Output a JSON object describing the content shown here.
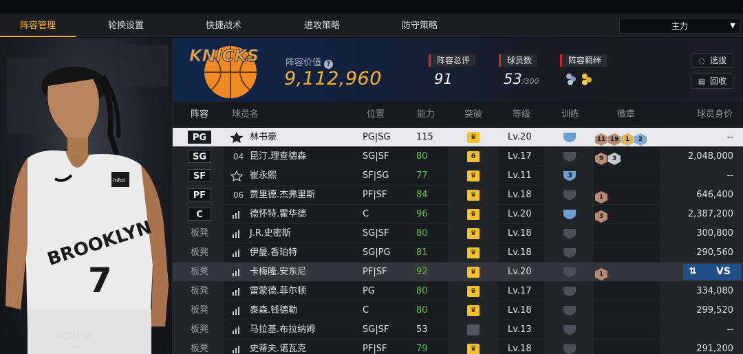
{
  "tabs": [
    "阵容管理",
    "轮换设置",
    "快捷战术",
    "进攻策略",
    "防守策略"
  ],
  "lineup_select": "主力",
  "player_panel": {
    "value_label": "时刻价值",
    "value": "--",
    "jersey_team": "BROOKLYN",
    "jersey_number": "7",
    "jersey_sponsor": "infor"
  },
  "summary": {
    "team_logo_text": "KNICKS",
    "team_value_label": "阵容价值",
    "team_value": "9,112,960",
    "rating_label": "阵容总评",
    "rating": "91",
    "players_label": "球员数",
    "players": "53",
    "players_max": "/300",
    "chemistry_label": "阵容羁绊",
    "buttons": {
      "select": "选拔",
      "recycle": "回收"
    }
  },
  "columns": [
    "阵容",
    "球员名",
    "位置",
    "能力",
    "突破",
    "等级",
    "训练",
    "徽章",
    "球员身价"
  ],
  "rows": [
    {
      "slot": "PG",
      "num": "",
      "name": "林书豪",
      "pos": "PG|SG",
      "ovr": "115",
      "green": false,
      "level": "Lv.20",
      "train": "",
      "badges": [
        [
          "11",
          "bronze"
        ],
        [
          "19",
          "bronze"
        ],
        [
          "1",
          "gold"
        ],
        [
          "2",
          "blue"
        ]
      ],
      "value": "--",
      "crown": "♛"
    },
    {
      "slot": "SG",
      "num": "04",
      "name": "昆汀.理查德森",
      "pos": "SG|SF",
      "ovr": "80",
      "green": true,
      "level": "Lv.17",
      "train": "",
      "badges": [
        [
          "9",
          "bronze"
        ],
        [
          "3",
          "silver"
        ]
      ],
      "value": "2,048,000",
      "crown": "6"
    },
    {
      "slot": "SF",
      "num": "",
      "name": "崔永熙",
      "pos": "SF|SG",
      "ovr": "77",
      "green": true,
      "level": "Lv.11",
      "train": "3",
      "badges": [],
      "value": "--",
      "crown": "♛"
    },
    {
      "slot": "PF",
      "num": "06",
      "name": "贾里德.杰弗里斯",
      "pos": "PF|SF",
      "ovr": "84",
      "green": true,
      "level": "Lv.18",
      "train": "",
      "badges": [
        [
          "1",
          "bronze"
        ]
      ],
      "value": "646,400",
      "crown": "♛"
    },
    {
      "slot": "C",
      "num": "",
      "name": "德怀特.霍华德",
      "pos": "C",
      "ovr": "96",
      "green": true,
      "level": "Lv.20",
      "train": "",
      "badges": [
        [
          "3",
          "bronze"
        ]
      ],
      "value": "2,387,200",
      "crown": "♛"
    },
    {
      "slot": "板凳",
      "num": "",
      "name": "J.R.史密斯",
      "pos": "SG|SF",
      "ovr": "80",
      "green": true,
      "level": "Lv.18",
      "train": "",
      "badges": [],
      "value": "300,800",
      "crown": "♛"
    },
    {
      "slot": "板凳",
      "num": "",
      "name": "伊曼.香珀特",
      "pos": "SG|PG",
      "ovr": "81",
      "green": true,
      "level": "Lv.18",
      "train": "",
      "badges": [],
      "value": "290,560",
      "crown": "♛"
    },
    {
      "slot": "板凳",
      "num": "",
      "name": "卡梅隆.安东尼",
      "pos": "PF|SF",
      "ovr": "92",
      "green": true,
      "level": "Lv.20",
      "train": "",
      "badges": [
        [
          "1",
          "bronze"
        ]
      ],
      "value": "VS",
      "crown": "♛"
    },
    {
      "slot": "板凳",
      "num": "",
      "name": "雷蒙德.菲尔顿",
      "pos": "PG",
      "ovr": "80",
      "green": true,
      "level": "Lv.17",
      "train": "",
      "badges": [],
      "value": "334,080",
      "crown": "♛"
    },
    {
      "slot": "板凳",
      "num": "",
      "name": "泰森.钱德勒",
      "pos": "C",
      "ovr": "80",
      "green": true,
      "level": "Lv.18",
      "train": "",
      "badges": [],
      "value": "299,520",
      "crown": "♛"
    },
    {
      "slot": "板凳",
      "num": "",
      "name": "马拉基.布拉纳姆",
      "pos": "SG|SF",
      "ovr": "53",
      "green": false,
      "level": "Lv.13",
      "train": "",
      "badges": [],
      "value": "--",
      "crown": ""
    },
    {
      "slot": "板凳",
      "num": "",
      "name": "史蒂夫.诺瓦克",
      "pos": "PF|SF",
      "ovr": "79",
      "green": true,
      "level": "Lv.18",
      "train": "",
      "badges": [],
      "value": "291,200",
      "crown": "♛"
    }
  ],
  "colors": {
    "accent": "#f2b331",
    "red_tag": "#d2262b",
    "green": "#56c443",
    "vs_blue": "#1f4f86"
  }
}
